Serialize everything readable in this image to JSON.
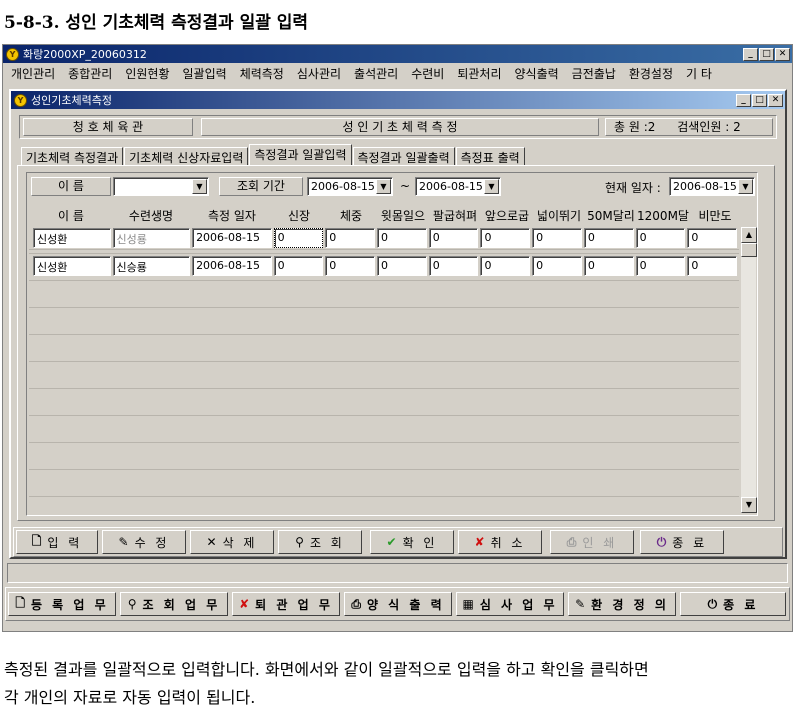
{
  "doc": {
    "heading": "5-8-3. 성인 기초체력 측정결과 일괄 입력",
    "caption_line1": "측정된 결과를 일괄적으로 입력합니다. 화면에서와 같이 일괄적으로 입력을 하고 확인을 클릭하면",
    "caption_line2": "각 개인의 자료로 자동 입력이 됩니다."
  },
  "app": {
    "title": "화랑2000XP_20060312",
    "menu": [
      "개인관리",
      "종합관리",
      "인원현황",
      "일괄입력",
      "체력측정",
      "심사관리",
      "출석관리",
      "수련비",
      "퇴관처리",
      "양식출력",
      "금전출납",
      "환경설정",
      "기 타"
    ]
  },
  "child": {
    "title": "성인기초체력측정",
    "info": {
      "gym": "청 호 체 육 관",
      "screen": "성 인 기 초 체 력 측 정",
      "total_label": "총 원 :",
      "total_value": "2",
      "search_label": "검색인원 :",
      "search_value": "2"
    },
    "tabs": [
      "기초체력 측정결과",
      "기초체력 신상자료입력",
      "측정결과 일괄입력",
      "측정결과 일괄출력",
      "측정표 출력"
    ],
    "active_tab": 2,
    "filter": {
      "name_label": "이  름",
      "name_value": "",
      "period_label": "조회 기간",
      "date_from": "2006-08-15",
      "tilde": "~",
      "date_to": "2006-08-15",
      "today_label": "현재 일자 :",
      "today_value": "2006-08-15"
    },
    "columns": [
      "이 름",
      "수련생명",
      "측정 일자",
      "신장",
      "체중",
      "윗몸일으",
      "팔굽혀펴",
      "앞으로굽",
      "넓이뛰기",
      "50M달리",
      "1200M달",
      "비만도"
    ],
    "rows": [
      [
        "신성환",
        "신성룡",
        "2006-08-15",
        "0",
        "0",
        "0",
        "0",
        "0",
        "0",
        "0",
        "0",
        "0"
      ],
      [
        "신성환",
        "신승룡",
        "2006-08-15",
        "0",
        "0",
        "0",
        "0",
        "0",
        "0",
        "0",
        "0",
        "0"
      ]
    ]
  },
  "actions": [
    {
      "icon": "🗋",
      "label": "입 력",
      "enabled": true
    },
    {
      "icon": "✎",
      "label": "수 정",
      "enabled": true
    },
    {
      "icon": "✕",
      "label": "삭 제",
      "enabled": true
    },
    {
      "icon": "⚲",
      "label": "조 회",
      "enabled": true
    },
    {
      "icon": "✔",
      "label": "확 인",
      "enabled": true
    },
    {
      "icon": "✘",
      "label": "취 소",
      "enabled": true
    },
    {
      "icon": "⎙",
      "label": "인 쇄",
      "enabled": false
    },
    {
      "icon": "⏻",
      "label": "종 료",
      "enabled": true
    }
  ],
  "bottom_bar": [
    {
      "icon": "🗋",
      "label": "등 록 업 무"
    },
    {
      "icon": "⚲",
      "label": "조 회 업 무"
    },
    {
      "icon": "✘",
      "label": "퇴 관 업 무"
    },
    {
      "icon": "⎙",
      "label": "양 식 출 력"
    },
    {
      "icon": "▦",
      "label": "심 사 업 무"
    },
    {
      "icon": "✎",
      "label": "환 경 정 의"
    },
    {
      "icon": "⏻",
      "label": "종          료"
    }
  ],
  "colors": {
    "check": "#2a9a2a",
    "cross": "#d01010",
    "titlebar": "#0a246a"
  }
}
